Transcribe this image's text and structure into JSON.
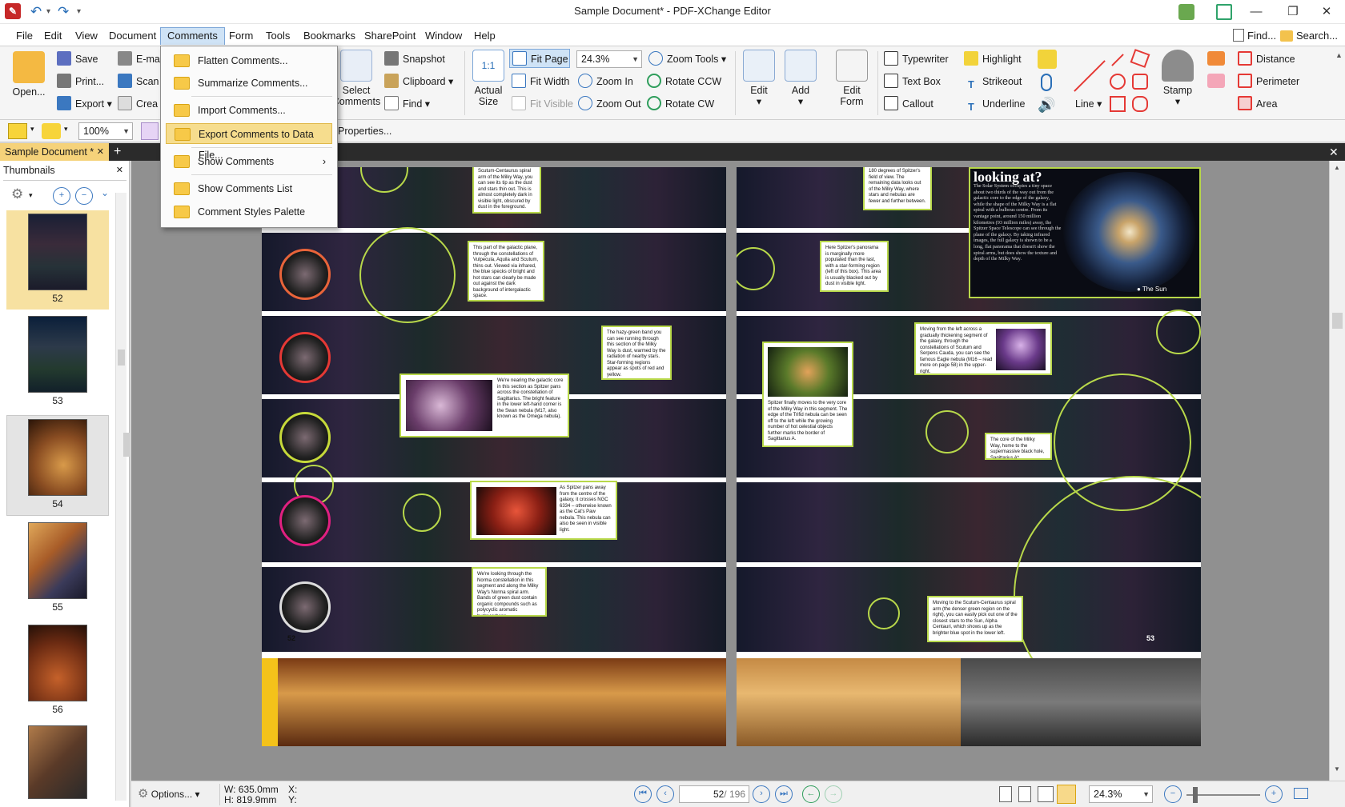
{
  "window": {
    "title": "Sample Document* - PDF-XChange Editor",
    "minimize_glyph": "—",
    "restore_glyph": "❐",
    "close_glyph": "✕"
  },
  "menubar": [
    "File",
    "Edit",
    "View",
    "Document",
    "Comments",
    "Form",
    "Tools",
    "Bookmarks",
    "SharePoint",
    "Window",
    "Help"
  ],
  "menubar_right": {
    "find": "Find...",
    "search": "Search..."
  },
  "ribbon": {
    "open": "Open...",
    "save": "Save",
    "email": "E-ma",
    "print": "Print...",
    "scan": "Scan",
    "export": "Export",
    "create": "Crea",
    "select_comments": [
      "Select",
      "Comments"
    ],
    "snapshot": "Snapshot",
    "clipboard": "Clipboard",
    "find": "Find",
    "actual_size": [
      "Actual",
      "Size"
    ],
    "fit_page": "Fit Page",
    "fit_width": "Fit Width",
    "fit_visible": "Fit Visible",
    "zoom_value": "24.3%",
    "zoom_tools": "Zoom Tools",
    "zoom_in": "Zoom In",
    "zoom_out": "Zoom Out",
    "rotate_ccw": "Rotate CCW",
    "rotate_cw": "Rotate CW",
    "edit": "Edit",
    "add": "Add",
    "edit_form": [
      "Edit",
      "Form"
    ],
    "typewriter": "Typewriter",
    "text_box": "Text Box",
    "callout": "Callout",
    "highlight": "Highlight",
    "strikeout": "Strikeout",
    "underline": "Underline",
    "line": "Line",
    "stamp": "Stamp",
    "distance": "Distance",
    "perimeter": "Perimeter",
    "area": "Area"
  },
  "toolbar2": {
    "opacity": "100%",
    "properties": "Properties..."
  },
  "tabs": {
    "document_tab": "Sample Document *",
    "add_tab": "+"
  },
  "thumbnails": {
    "title": "Thumbnails",
    "pages": [
      "52",
      "53",
      "54",
      "55",
      "56"
    ]
  },
  "comments_menu": {
    "items": [
      "Flatten Comments...",
      "Summarize Comments...",
      "Import Comments...",
      "Export Comments to Data File...",
      "Show Comments",
      "Show Comments List",
      "Comment Styles Palette"
    ],
    "submenu_arrow": "›"
  },
  "document": {
    "left_page_number": "52",
    "right_page_number": "53",
    "heading": "looking at?",
    "sun_label": "The Sun",
    "captions": {
      "c1": "Scutum-Centaurus spiral arm of the Milky Way, you can see its tip as the dust and stars thin out. This is almost completely dark in visible light, obscured by dust in the foreground.",
      "c2": "This part of the galactic plane, through the constellations of Vulpecula, Aquila and Scutum, thins out. Viewed via infrared, the blue specks of bright and hot stars can clearly be made out against the dark background of intergalactic space.",
      "c3": "The hazy-green band you can see running through this section of the Milky Way is dust, warmed by the radiation of nearby stars. Star-forming regions appear as spots of red and yellow.",
      "c4": "We're nearing the galactic core in this section as Spitzer pans across the constellation of Sagittarius. The bright feature in the lower left-hand corner is the Swan nebula (M17, also known as the Omega nebula).",
      "c5": "As Spitzer pans away from the centre of the galaxy, it crosses NGC 6334 – otherwise known as the Cat's Paw nebula. This nebula can also be seen in visible light.",
      "c6": "We're looking through the Norma constellation in this segment and along the Milky Way's Norma spiral arm. Bands of green dust contain organic compounds such as polycyclic aromatic hydrocarbons.",
      "c7": "180 degrees of Spitzer's field of view. The remaining data looks out of the Milky Way, where stars and nebulas are fewer and further between.",
      "c8": "Here Spitzer's panorama is marginally more populated than the last, with a star-forming region (left of this box). This area is usually blacked out by dust in visible light.",
      "c9": "Moving from the left across a gradually thickening segment of the galaxy, through the constellations of Scutum and Serpens Cauda, you can see the famous Eagle nebula (M16 – read more on page 58) in the upper-right.",
      "c10": "Spitzer finally moves to the very core of the Milky Way in this segment. The edge of the Trifid nebula can be seen off to the left while the growing number of hot celestial objects further marks the border of Sagittarius A.",
      "c11": "The core of the Milky Way, home to the supermassive black hole, Sagittarius A*",
      "c12": "Moving to the Scutum-Centaurus spiral arm (the denser green region on the right), you can easily pick out one of the closest stars to the Sun, Alpha Centauri, which shows up as the brighter blue spot in the lower left.",
      "c13": "The Solar System occupies a tiny space about two thirds of the way out from the galactic core to the edge of the galaxy, while the shape of the Milky Way is a flat spiral with a bulbous centre. From its vantage point, around 150 million kilometres (93 million miles) away, the Spitzer Space Telescope can see through the plane of the galaxy. By taking infrared images, the full galaxy is shown to be a long, flat panorama that doesn't show the spiral arms, but does show the texture and depth of the Milky Way."
    }
  },
  "statusbar": {
    "options": "Options...",
    "width": "W: 635.0mm",
    "height": "H: 819.9mm",
    "x": "X:",
    "y": "Y:",
    "page_current": "52",
    "page_total": "/ 196",
    "zoom": "24.3%"
  },
  "colors": {
    "accent_blue": "#2a6fb8",
    "active_menu": "#cfe3f6",
    "highlight_item": "#f6dd8e",
    "tab_gold": "#f5d27a",
    "caption_border": "#b8d84a"
  }
}
